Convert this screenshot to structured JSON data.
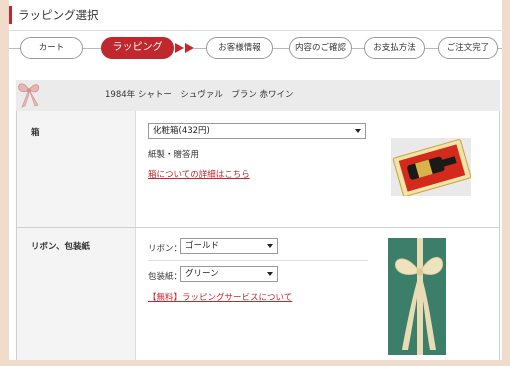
{
  "page": {
    "title": "ラッピング選択"
  },
  "steps": [
    {
      "label": "カート"
    },
    {
      "label": "ラッピング"
    },
    {
      "label": "お客様情報"
    },
    {
      "label": "内容のご確認"
    },
    {
      "label": "お支払方法"
    },
    {
      "label": "ご注文完了"
    }
  ],
  "product": {
    "name": "1984年 シャトー　シュヴァル　ブラン 赤ワイン"
  },
  "box": {
    "label": "箱",
    "selected": "化粧箱(432円)",
    "material": "紙製・贈答用",
    "detail_link": "箱についての詳細はこちら"
  },
  "wrap": {
    "label": "リボン、包装紙",
    "ribbon_label": "リボン：",
    "ribbon_selected": "ゴールド",
    "paper_label": "包装紙：",
    "paper_selected": "グリーン",
    "service_link": "【無料】ラッピングサービスについて"
  },
  "colors": {
    "accent": "#c0282d",
    "background": "#f1dccb",
    "paper_green": "#3b7f6a",
    "ribbon_gold": "#e9dcb4"
  }
}
